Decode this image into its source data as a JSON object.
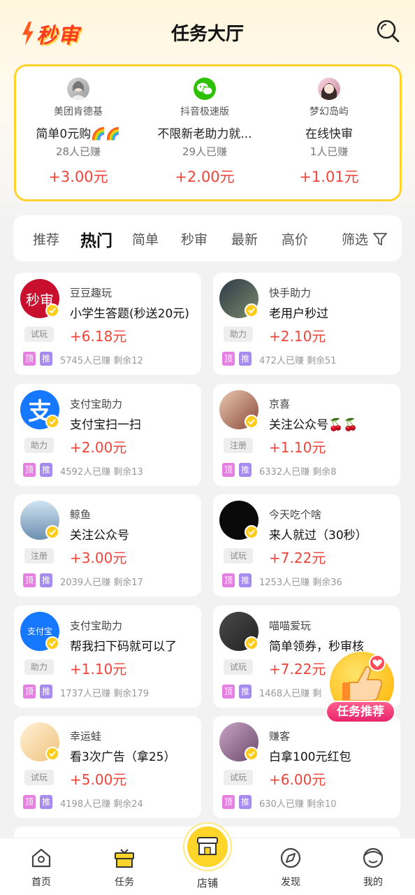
{
  "header": {
    "logo_text": "秒审",
    "title": "任务大厅"
  },
  "featured": [
    {
      "name": "美团肯德基",
      "task": "简单0元购🌈🌈",
      "earned": "28人已赚",
      "price": "+3.00元"
    },
    {
      "name": "抖音极速版",
      "task": "不限新老助力就...",
      "earned": "29人已赚",
      "price": "+2.00元"
    },
    {
      "name": "梦幻岛屿",
      "task": "在线快审",
      "earned": "1人已赚",
      "price": "+1.01元"
    }
  ],
  "tabs": [
    "推荐",
    "热门",
    "简单",
    "秒审",
    "最新",
    "高价"
  ],
  "active_tab": "热门",
  "filter_label": "筛选",
  "tasks": [
    {
      "store": "豆豆趣玩",
      "task": "小学生答题(秒送20元)",
      "type": "试玩",
      "price": "+6.18元",
      "stats": "5745人已赚 剩余12",
      "avatar_text": "秒审"
    },
    {
      "store": "快手助力",
      "task": "老用户秒过",
      "type": "助力",
      "price": "+2.10元",
      "stats": "472人已赚 剩余51",
      "avatar_text": ""
    },
    {
      "store": "支付宝助力",
      "task": "支付宝扫一扫",
      "type": "助力",
      "price": "+2.00元",
      "stats": "4592人已赚 剩余13",
      "avatar_text": "支"
    },
    {
      "store": "京喜",
      "task": "关注公众号🍒🍒",
      "type": "注册",
      "price": "+1.10元",
      "stats": "6332人已赚 剩余8",
      "avatar_text": ""
    },
    {
      "store": "鲸鱼",
      "task": "关注公众号",
      "type": "注册",
      "price": "+3.00元",
      "stats": "2039人已赚 剩余17",
      "avatar_text": ""
    },
    {
      "store": "今天吃个啥",
      "task": "来人就过（30秒）",
      "type": "试玩",
      "price": "+7.22元",
      "stats": "1253人已赚 剩余36",
      "avatar_text": ""
    },
    {
      "store": "支付宝助力",
      "task": "帮我扫下码就可以了",
      "type": "助力",
      "price": "+1.10元",
      "stats": "1737人已赚 剩余179",
      "avatar_text": "支付宝"
    },
    {
      "store": "喵喵爱玩",
      "task": "简单领券，秒审核",
      "type": "试玩",
      "price": "+7.22元",
      "stats": "1468人已赚 剩",
      "avatar_text": ""
    },
    {
      "store": "幸运蛙",
      "task": "看3次广告（拿25）",
      "type": "试玩",
      "price": "+5.00元",
      "stats": "4198人已赚 剩余24",
      "avatar_text": ""
    },
    {
      "store": "赚客",
      "task": "白拿100元红包",
      "type": "试玩",
      "price": "+6.00元",
      "stats": "630人已赚 剩余10",
      "avatar_text": ""
    }
  ],
  "tag_top": "顶",
  "tag_rec": "推",
  "float_label": "任务推荐",
  "nav": {
    "home": "首页",
    "tasks": "任务",
    "shop": "店铺",
    "discover": "发现",
    "mine": "我的"
  },
  "colors": {
    "accent": "#ffd32c",
    "price": "#f0443a",
    "tag_top": "#e57fe2",
    "tag_rec": "#a58bf0"
  }
}
